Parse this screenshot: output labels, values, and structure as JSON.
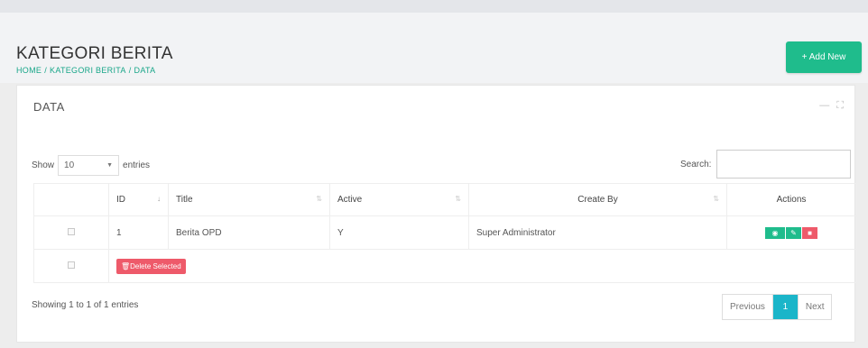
{
  "header": {
    "title": "KATEGORI BERITA",
    "breadcrumb": [
      "HOME",
      "KATEGORI BERITA",
      "DATA"
    ],
    "add_button_label": "+ Add New"
  },
  "card": {
    "title": "DATA",
    "tools": {
      "minimize_icon": "minus-icon",
      "expand_icon": "expand-icon"
    }
  },
  "table_controls": {
    "show_label": "Show",
    "entries_label": "entries",
    "page_length": "10",
    "search_label": "Search:",
    "search_value": ""
  },
  "table": {
    "columns": [
      "ID",
      "Title",
      "Active",
      "Create By",
      "Actions"
    ],
    "rows": [
      {
        "id": "1",
        "title": "Berita OPD",
        "active": "Y",
        "create_by": "Super Administrator"
      }
    ],
    "delete_selected_label": "Delete Selected"
  },
  "footer": {
    "info": "Showing 1 to 1 of 1 entries",
    "pagination": {
      "previous": "Previous",
      "current": "1",
      "next": "Next"
    }
  },
  "colors": {
    "primary": "#1fbc8c",
    "danger": "#ee5a6a",
    "page_active": "#1bb5c9",
    "breadcrumb": "#18a689"
  }
}
